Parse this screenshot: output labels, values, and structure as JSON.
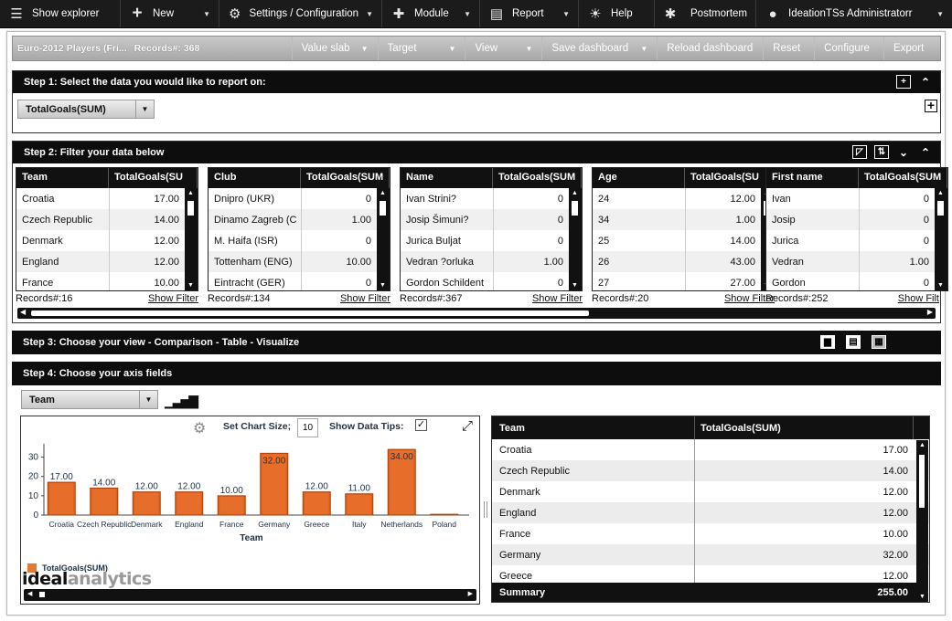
{
  "topbar": {
    "items": [
      {
        "label": "Show explorer",
        "icon": "list-icon",
        "dropdown": false
      },
      {
        "label": "New",
        "icon": "plus-icon",
        "dropdown": true
      },
      {
        "label": "Settings / Configuration",
        "icon": "gear-icon",
        "dropdown": true
      },
      {
        "label": "Module",
        "icon": "puzzle-icon",
        "dropdown": true
      },
      {
        "label": "Report",
        "icon": "report-icon",
        "dropdown": true
      },
      {
        "label": "Help",
        "icon": "lightbulb-icon",
        "dropdown": false
      },
      {
        "label": "Postmortem",
        "icon": "bug-icon",
        "dropdown": false
      },
      {
        "label": "IdeationTSs Administratorr",
        "icon": "user-icon",
        "dropdown": true
      }
    ]
  },
  "dashboard": {
    "title": "Euro-2012 Players (Fri...",
    "records": "Records#: 368",
    "buttons": [
      {
        "label": "Value slab",
        "dropdown": true
      },
      {
        "label": "Target",
        "dropdown": true
      },
      {
        "label": "View",
        "dropdown": true
      },
      {
        "label": "Save dashboard",
        "dropdown": true
      },
      {
        "label": "Reload dashboard",
        "dropdown": false
      },
      {
        "label": "Reset",
        "dropdown": false
      },
      {
        "label": "Configure",
        "dropdown": false
      },
      {
        "label": "Export",
        "dropdown": false
      }
    ]
  },
  "step1": {
    "title": "Step 1: Select the data you would like to report on:",
    "measure": "TotalGoals(SUM)"
  },
  "step2": {
    "title": "Step 2: Filter your data below",
    "filters": [
      {
        "col1": "Team",
        "col2": "TotalGoals(SU",
        "rows": [
          [
            "Croatia",
            "17.00"
          ],
          [
            "Czech Republic",
            "14.00"
          ],
          [
            "Denmark",
            "12.00"
          ],
          [
            "England",
            "12.00"
          ],
          [
            "France",
            "10.00"
          ]
        ],
        "records": "Records#:16",
        "show_filter": "Show Filter"
      },
      {
        "col1": "Club",
        "col2": "TotalGoals(SUM",
        "rows": [
          [
            "Dnipro (UKR)",
            "0"
          ],
          [
            "Dinamo Zagreb (C",
            "1.00"
          ],
          [
            "M. Haifa (ISR)",
            "0"
          ],
          [
            "Tottenham (ENG)",
            "10.00"
          ],
          [
            "Eintracht (GER)",
            "0"
          ]
        ],
        "records": "Records#:134",
        "show_filter": "Show Filter"
      },
      {
        "col1": "Name",
        "col2": "TotalGoals(SUM",
        "rows": [
          [
            "Ivan Strini?",
            "0"
          ],
          [
            "Josip Šimuni?",
            "0"
          ],
          [
            "Jurica Buljat",
            "0"
          ],
          [
            "Vedran ?orluka",
            "1.00"
          ],
          [
            "Gordon Schildent",
            "0"
          ]
        ],
        "records": "Records#:367",
        "show_filter": "Show Filter"
      },
      {
        "col1": "Age",
        "col2": "TotalGoals(SU",
        "rows": [
          [
            "24",
            "12.00"
          ],
          [
            "34",
            "1.00"
          ],
          [
            "25",
            "14.00"
          ],
          [
            "26",
            "43.00"
          ],
          [
            "27",
            "27.00"
          ]
        ],
        "records": "Records#:20",
        "show_filter": "Show Filter"
      },
      {
        "col1": "First name",
        "col2": "TotalGoals(SUM",
        "rows": [
          [
            "Ivan",
            "0"
          ],
          [
            "Josip",
            "0"
          ],
          [
            "Jurica",
            "0"
          ],
          [
            "Vedran",
            "1.00"
          ],
          [
            "Gordon",
            "0"
          ]
        ],
        "records": "Records#:252",
        "show_filter": "Show Filt"
      }
    ]
  },
  "step3": {
    "title": "Step 3: Choose your view - Comparison - Table - Visualize"
  },
  "step4": {
    "title": "Step 4: Choose your axis fields",
    "axis_field": "Team",
    "set_chart_size_label": "Set Chart Size;",
    "chart_size_value": "10",
    "show_data_tips_label": "Show Data Tips:",
    "show_data_tips_checked": true
  },
  "chart_data": {
    "type": "bar",
    "categories": [
      "Croatia",
      "Czech Republic",
      "Denmark",
      "England",
      "France",
      "Germany",
      "Greece",
      "Italy",
      "Netherlands",
      "Poland"
    ],
    "values": [
      17,
      14,
      12,
      12,
      10,
      32,
      12,
      11,
      34,
      0.4
    ],
    "value_labels": [
      "17.00",
      "14.00",
      "12.00",
      "12.00",
      "10.00",
      "32.00",
      "12.00",
      "11.00",
      "34.00",
      ""
    ],
    "xlabel": "Team",
    "ylabel": "",
    "ylim": [
      0,
      35
    ],
    "yticks": [
      "0",
      "10",
      "20",
      "30"
    ],
    "legend": "TotalGoals(SUM)",
    "bar_color": "#e0601a",
    "bar_color_dark": "#a8400c"
  },
  "grid": {
    "col1": "Team",
    "col2": "TotalGoals(SUM)",
    "rows": [
      [
        "Croatia",
        "17.00"
      ],
      [
        "Czech Republic",
        "14.00"
      ],
      [
        "Denmark",
        "12.00"
      ],
      [
        "England",
        "12.00"
      ],
      [
        "France",
        "10.00"
      ],
      [
        "Germany",
        "32.00"
      ],
      [
        "Greece",
        "12.00"
      ]
    ],
    "summary_label": "Summary",
    "summary_value": "255.00"
  },
  "logo": {
    "part1": "ideal",
    "part2": "analytics"
  }
}
